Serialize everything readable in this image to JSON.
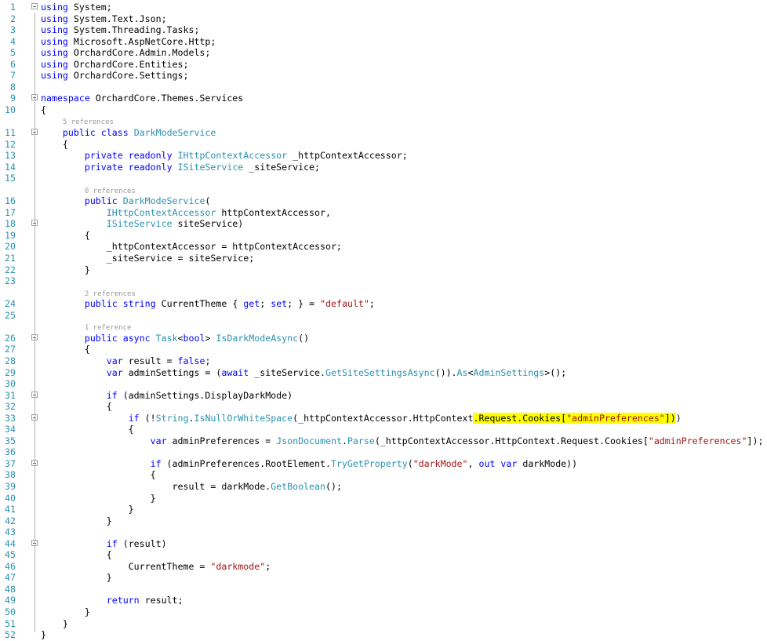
{
  "editor": {
    "lines": [
      {
        "n": "1",
        "fold": true,
        "tokens": [
          {
            "t": "using",
            "c": "kw"
          },
          {
            "t": " System;"
          }
        ]
      },
      {
        "n": "2",
        "tokens": [
          {
            "t": "using",
            "c": "kw"
          },
          {
            "t": " System.Text.Json;"
          }
        ]
      },
      {
        "n": "3",
        "tokens": [
          {
            "t": "using",
            "c": "kw"
          },
          {
            "t": " System.Threading.Tasks;"
          }
        ]
      },
      {
        "n": "4",
        "tokens": [
          {
            "t": "using",
            "c": "kw"
          },
          {
            "t": " Microsoft.AspNetCore.Http;"
          }
        ]
      },
      {
        "n": "5",
        "tokens": [
          {
            "t": "using",
            "c": "kw"
          },
          {
            "t": " OrchardCore.Admin.Models;"
          }
        ]
      },
      {
        "n": "6",
        "tokens": [
          {
            "t": "using",
            "c": "kw"
          },
          {
            "t": " OrchardCore.Entities;"
          }
        ]
      },
      {
        "n": "7",
        "tokens": [
          {
            "t": "using",
            "c": "kw"
          },
          {
            "t": " OrchardCore.Settings;"
          }
        ]
      },
      {
        "n": "8",
        "tokens": []
      },
      {
        "n": "9",
        "fold": true,
        "tokens": [
          {
            "t": "namespace",
            "c": "kw"
          },
          {
            "t": " OrchardCore.Themes.Services"
          }
        ]
      },
      {
        "n": "10",
        "tokens": [
          {
            "t": "{"
          }
        ]
      },
      {
        "ref": "5 references",
        "indent": "    "
      },
      {
        "n": "11",
        "fold": true,
        "tokens": [
          {
            "t": "    "
          },
          {
            "t": "public",
            "c": "kw"
          },
          {
            "t": " "
          },
          {
            "t": "class",
            "c": "kw"
          },
          {
            "t": " "
          },
          {
            "t": "DarkModeService",
            "c": "ty"
          }
        ]
      },
      {
        "n": "12",
        "tokens": [
          {
            "t": "    {"
          }
        ]
      },
      {
        "n": "13",
        "tokens": [
          {
            "t": "        "
          },
          {
            "t": "private",
            "c": "kw"
          },
          {
            "t": " "
          },
          {
            "t": "readonly",
            "c": "kw"
          },
          {
            "t": " "
          },
          {
            "t": "IHttpContextAccessor",
            "c": "ty"
          },
          {
            "t": " _httpContextAccessor;"
          }
        ]
      },
      {
        "n": "14",
        "tokens": [
          {
            "t": "        "
          },
          {
            "t": "private",
            "c": "kw"
          },
          {
            "t": " "
          },
          {
            "t": "readonly",
            "c": "kw"
          },
          {
            "t": " "
          },
          {
            "t": "ISiteService",
            "c": "ty"
          },
          {
            "t": " _siteService;"
          }
        ]
      },
      {
        "n": "15",
        "tokens": []
      },
      {
        "ref": "0 references",
        "indent": "        "
      },
      {
        "n": "16",
        "tokens": [
          {
            "t": "        "
          },
          {
            "t": "public",
            "c": "kw"
          },
          {
            "t": " "
          },
          {
            "t": "DarkModeService",
            "c": "ty"
          },
          {
            "t": "("
          }
        ]
      },
      {
        "n": "17",
        "tokens": [
          {
            "t": "            "
          },
          {
            "t": "IHttpContextAccessor",
            "c": "ty"
          },
          {
            "t": " httpContextAccessor,"
          }
        ]
      },
      {
        "n": "18",
        "fold": true,
        "tokens": [
          {
            "t": "            "
          },
          {
            "t": "ISiteService",
            "c": "ty"
          },
          {
            "t": " siteService)"
          }
        ]
      },
      {
        "n": "19",
        "tokens": [
          {
            "t": "        {"
          }
        ]
      },
      {
        "n": "20",
        "tokens": [
          {
            "t": "            _httpContextAccessor = httpContextAccessor;"
          }
        ]
      },
      {
        "n": "21",
        "tokens": [
          {
            "t": "            _siteService = siteService;"
          }
        ]
      },
      {
        "n": "22",
        "tokens": [
          {
            "t": "        }"
          }
        ]
      },
      {
        "n": "23",
        "tokens": []
      },
      {
        "ref": "2 references",
        "indent": "        "
      },
      {
        "n": "24",
        "tokens": [
          {
            "t": "        "
          },
          {
            "t": "public",
            "c": "kw"
          },
          {
            "t": " "
          },
          {
            "t": "string",
            "c": "kw"
          },
          {
            "t": " CurrentTheme { "
          },
          {
            "t": "get",
            "c": "kw"
          },
          {
            "t": "; "
          },
          {
            "t": "set",
            "c": "kw"
          },
          {
            "t": "; } = "
          },
          {
            "t": "\"default\"",
            "c": "st"
          },
          {
            "t": ";"
          }
        ]
      },
      {
        "n": "25",
        "tokens": []
      },
      {
        "ref": "1 reference",
        "indent": "        "
      },
      {
        "n": "26",
        "fold": true,
        "tokens": [
          {
            "t": "        "
          },
          {
            "t": "public",
            "c": "kw"
          },
          {
            "t": " "
          },
          {
            "t": "async",
            "c": "kw"
          },
          {
            "t": " "
          },
          {
            "t": "Task",
            "c": "ty"
          },
          {
            "t": "<"
          },
          {
            "t": "bool",
            "c": "kw"
          },
          {
            "t": "> "
          },
          {
            "t": "IsDarkModeAsync",
            "c": "ty"
          },
          {
            "t": "()"
          }
        ]
      },
      {
        "n": "27",
        "tokens": [
          {
            "t": "        {"
          }
        ]
      },
      {
        "n": "28",
        "tokens": [
          {
            "t": "            "
          },
          {
            "t": "var",
            "c": "kw"
          },
          {
            "t": " result = "
          },
          {
            "t": "false",
            "c": "kw"
          },
          {
            "t": ";"
          }
        ]
      },
      {
        "n": "29",
        "tokens": [
          {
            "t": "            "
          },
          {
            "t": "var",
            "c": "kw"
          },
          {
            "t": " adminSettings = ("
          },
          {
            "t": "await",
            "c": "kw"
          },
          {
            "t": " _siteService."
          },
          {
            "t": "GetSiteSettingsAsync",
            "c": "ty"
          },
          {
            "t": "())."
          },
          {
            "t": "As",
            "c": "ty"
          },
          {
            "t": "<"
          },
          {
            "t": "AdminSettings",
            "c": "ty"
          },
          {
            "t": ">();"
          }
        ]
      },
      {
        "n": "30",
        "tokens": []
      },
      {
        "n": "31",
        "fold": true,
        "tokens": [
          {
            "t": "            "
          },
          {
            "t": "if",
            "c": "kw"
          },
          {
            "t": " (adminSettings.DisplayDarkMode)"
          }
        ]
      },
      {
        "n": "32",
        "tokens": [
          {
            "t": "            {"
          }
        ]
      },
      {
        "n": "33",
        "fold": true,
        "tokens": [
          {
            "t": "                "
          },
          {
            "t": "if",
            "c": "kw"
          },
          {
            "t": " (!"
          },
          {
            "t": "String",
            "c": "ty"
          },
          {
            "t": "."
          },
          {
            "t": "IsNullOrWhiteSpace",
            "c": "ty"
          },
          {
            "t": "(_httpContextAccessor.HttpContext"
          },
          {
            "t": ".Request.Cookies[",
            "c": "hl"
          },
          {
            "t": "\"adminPreferences\"",
            "c": "st hl"
          },
          {
            "t": "])",
            "c": "hl"
          },
          {
            "t": ")"
          }
        ]
      },
      {
        "n": "34",
        "tokens": [
          {
            "t": "                {"
          }
        ]
      },
      {
        "n": "35",
        "tokens": [
          {
            "t": "                    "
          },
          {
            "t": "var",
            "c": "kw"
          },
          {
            "t": " adminPreferences = "
          },
          {
            "t": "JsonDocument",
            "c": "ty"
          },
          {
            "t": "."
          },
          {
            "t": "Parse",
            "c": "ty"
          },
          {
            "t": "(_httpContextAccessor.HttpContext.Request.Cookies["
          },
          {
            "t": "\"adminPreferences\"",
            "c": "st"
          },
          {
            "t": "]);"
          }
        ]
      },
      {
        "n": "36",
        "tokens": []
      },
      {
        "n": "37",
        "fold": true,
        "tokens": [
          {
            "t": "                    "
          },
          {
            "t": "if",
            "c": "kw"
          },
          {
            "t": " (adminPreferences.RootElement."
          },
          {
            "t": "TryGetProperty",
            "c": "ty"
          },
          {
            "t": "("
          },
          {
            "t": "\"darkMode\"",
            "c": "st"
          },
          {
            "t": ", "
          },
          {
            "t": "out",
            "c": "kw"
          },
          {
            "t": " "
          },
          {
            "t": "var",
            "c": "kw"
          },
          {
            "t": " darkMode))"
          }
        ]
      },
      {
        "n": "38",
        "tokens": [
          {
            "t": "                    {"
          }
        ]
      },
      {
        "n": "39",
        "tokens": [
          {
            "t": "                        result = darkMode."
          },
          {
            "t": "GetBoolean",
            "c": "ty"
          },
          {
            "t": "();"
          }
        ]
      },
      {
        "n": "40",
        "tokens": [
          {
            "t": "                    }"
          }
        ]
      },
      {
        "n": "41",
        "tokens": [
          {
            "t": "                }"
          }
        ]
      },
      {
        "n": "42",
        "tokens": [
          {
            "t": "            }"
          }
        ]
      },
      {
        "n": "43",
        "tokens": []
      },
      {
        "n": "44",
        "fold": true,
        "tokens": [
          {
            "t": "            "
          },
          {
            "t": "if",
            "c": "kw"
          },
          {
            "t": " (result)"
          }
        ]
      },
      {
        "n": "45",
        "tokens": [
          {
            "t": "            {"
          }
        ]
      },
      {
        "n": "46",
        "tokens": [
          {
            "t": "                CurrentTheme = "
          },
          {
            "t": "\"darkmode\"",
            "c": "st"
          },
          {
            "t": ";"
          }
        ]
      },
      {
        "n": "47",
        "tokens": [
          {
            "t": "            }"
          }
        ]
      },
      {
        "n": "48",
        "tokens": []
      },
      {
        "n": "49",
        "tokens": [
          {
            "t": "            "
          },
          {
            "t": "return",
            "c": "kw"
          },
          {
            "t": " result;"
          }
        ]
      },
      {
        "n": "50",
        "tokens": [
          {
            "t": "        }"
          }
        ]
      },
      {
        "n": "51",
        "tokens": [
          {
            "t": "    }"
          }
        ]
      },
      {
        "n": "52",
        "tokens": [
          {
            "t": "}"
          }
        ]
      }
    ]
  }
}
